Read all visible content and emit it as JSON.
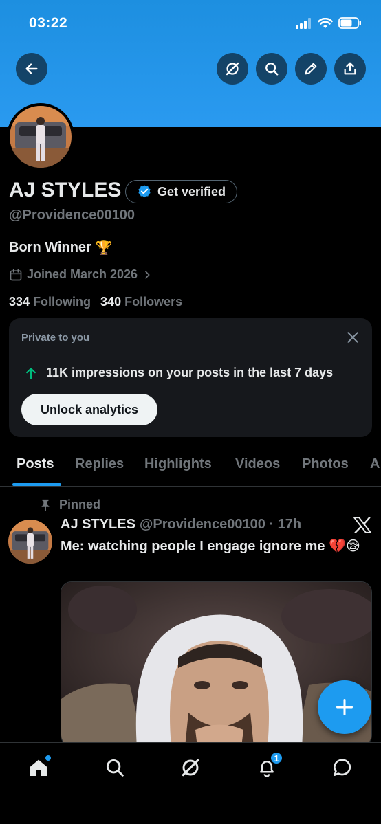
{
  "status_bar": {
    "time": "03:22"
  },
  "profile": {
    "name": "AJ STYLES",
    "verify_label": "Get verified",
    "handle": "@Providence00100",
    "bio": "Born Winner",
    "bio_emoji": "🏆",
    "joined": "Joined March 2026",
    "following_count": "334",
    "following_label": "Following",
    "followers_count": "340",
    "followers_label": "Followers"
  },
  "private_card": {
    "title": "Private to you",
    "impressions": "11K impressions on your posts in the last 7 days",
    "unlock_label": "Unlock analytics"
  },
  "tabs": [
    {
      "label": "Posts",
      "active": true
    },
    {
      "label": "Replies"
    },
    {
      "label": "Highlights"
    },
    {
      "label": "Videos"
    },
    {
      "label": "Photos"
    },
    {
      "label": "A"
    }
  ],
  "post": {
    "pinned_label": "Pinned",
    "author_name": "AJ STYLES",
    "author_meta": "@Providence00100 · 17h",
    "text": "Me: watching people I engage ignore me 💔😪"
  },
  "notifications_badge": "1",
  "colors": {
    "accent": "#1d9bf0",
    "banner": "#2a9af0",
    "background": "#000000",
    "secondary_text": "#71767b"
  },
  "icons": [
    "back-icon",
    "grok-icon",
    "search-icon",
    "edit-icon",
    "share-icon",
    "calendar-icon",
    "chevron-right-icon",
    "close-icon",
    "arrow-up-icon",
    "pin-icon",
    "x-logo-icon",
    "plus-icon",
    "home-icon",
    "notifications-icon",
    "messages-icon"
  ]
}
